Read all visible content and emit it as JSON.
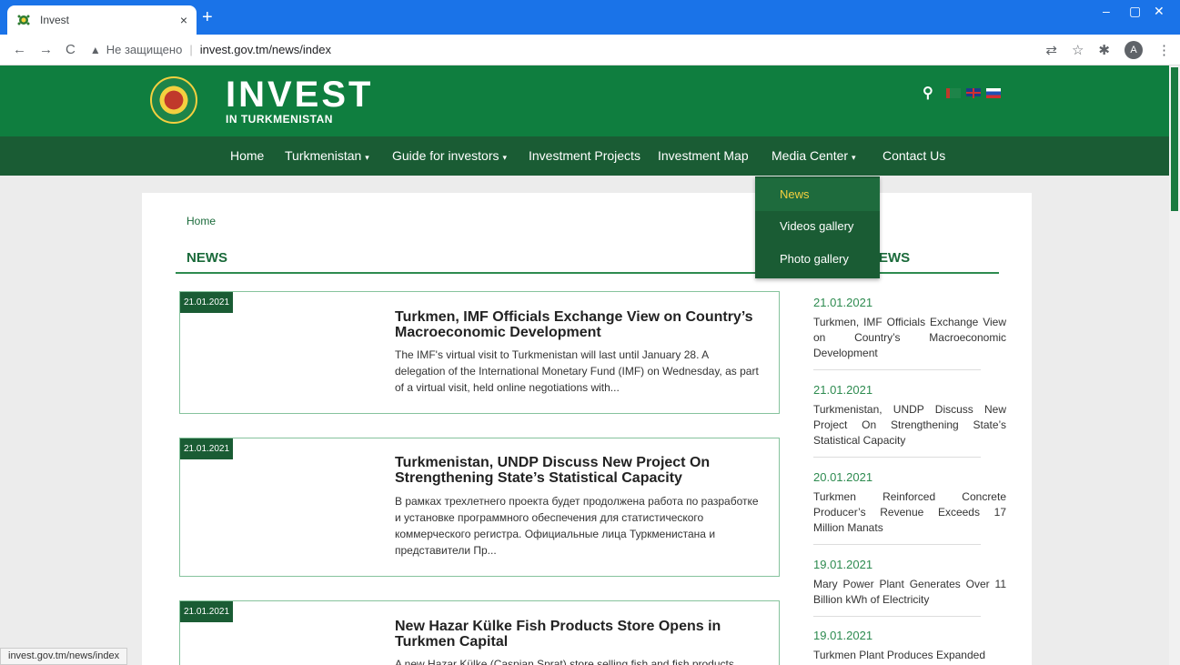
{
  "browser": {
    "tab_title": "Invest",
    "close_glyph": "×",
    "new_tab_glyph": "+",
    "back_glyph": "←",
    "forward_glyph": "→",
    "reload_glyph": "C",
    "security_glyph": "▲",
    "security_label": "Не защищено",
    "url_separator": "|",
    "url": "invest.gov.tm/news/index",
    "avatar_letter": "A",
    "status_url": "invest.gov.tm/news/index",
    "min_glyph": "–",
    "max_glyph": "▢",
    "close_win_glyph": "✕",
    "translate_glyph": "⇄",
    "star_glyph": "☆",
    "ext_glyph": "✱",
    "menu_glyph": "⋮"
  },
  "header": {
    "logo_main": "INVEST",
    "logo_sub": "IN TURKMENISTAN",
    "search_glyph": "⚲"
  },
  "nav": {
    "items": [
      {
        "label": "Home"
      },
      {
        "label": "Turkmenistan"
      },
      {
        "label": "Guide for investors"
      },
      {
        "label": "Investment Projects"
      },
      {
        "label": "Investment Map"
      },
      {
        "label": "Media Center"
      },
      {
        "label": "Contact Us"
      }
    ],
    "caret": "▾"
  },
  "dropdown": {
    "items": [
      {
        "label": "News"
      },
      {
        "label": "Videos gallery"
      },
      {
        "label": "Photo gallery"
      }
    ]
  },
  "page": {
    "breadcrumb": "Home",
    "title": "NEWS",
    "right_title": "EWS"
  },
  "news": [
    {
      "date": "21.01.2021",
      "title": "Turkmen, IMF Officials Exchange View on Country’s Macroeconomic Development",
      "desc": "The IMF's virtual visit to Turkmenistan will last until January 28. A delegation of the International Monetary Fund (IMF) on Wednesday, as part of a virtual visit, held online negotiations with..."
    },
    {
      "date": "21.01.2021",
      "title": "Turkmenistan, UNDP Discuss New Project On Strengthening State’s Statistical Capacity",
      "desc": "В рамках трехлетнего проекта будет продолжена работа по разработке и установке программного обеспечения для статистического коммерческого регистра. Официальные лица Туркменистана и представители Пр..."
    },
    {
      "date": "21.01.2021",
      "title": "New Hazar Külke Fish Products Store Opens in Turkmen Capital",
      "desc": "A new Hazar Külke (Caspian Sprat) store selling fish and fish products"
    }
  ],
  "latest": [
    {
      "date": "21.01.2021",
      "text": "Turkmen, IMF Officials Exchange View on Country’s Macroeconomic Development"
    },
    {
      "date": "21.01.2021",
      "text": "Turkmenistan, UNDP Discuss New Project On Strengthening State’s Statistical Capacity"
    },
    {
      "date": "20.01.2021",
      "text": "Turkmen Reinforced Concrete Producer’s Revenue Exceeds 17 Million Manats"
    },
    {
      "date": "19.01.2021",
      "text": "Mary Power Plant Generates Over 11 Billion kWh of Electricity"
    },
    {
      "date": "19.01.2021",
      "text": "Turkmen Plant Produces Expanded"
    }
  ]
}
